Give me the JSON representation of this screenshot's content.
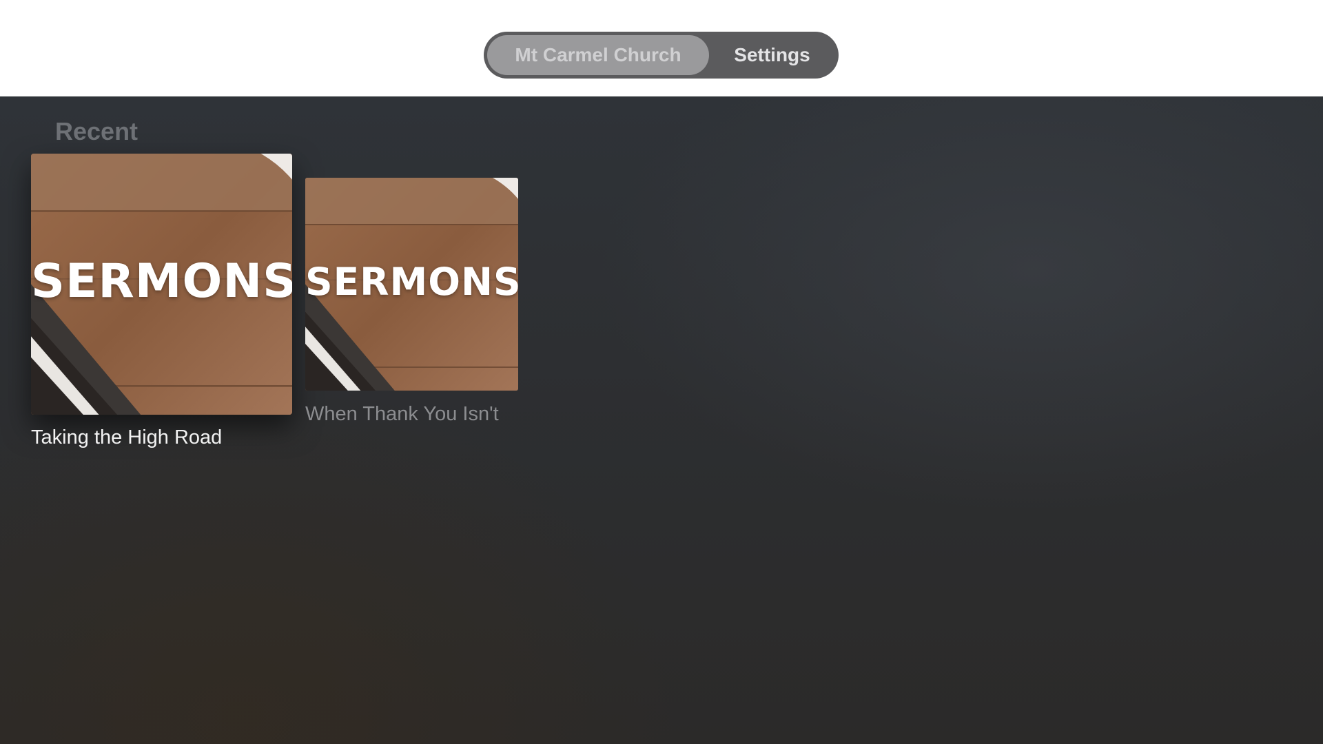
{
  "tabs": [
    {
      "label": "Mt Carmel Church",
      "selected": true
    },
    {
      "label": "Settings",
      "selected": false
    }
  ],
  "section": {
    "title": "Recent"
  },
  "items": [
    {
      "title": "Taking the High Road",
      "art_text": "SERMONS",
      "focused": true
    },
    {
      "title": "When Thank You Isn't",
      "art_text": "SERMONS",
      "focused": false
    }
  ],
  "colors": {
    "background_top": "#2f3338",
    "background_bottom": "#2b2a29",
    "tab_bar": "#5b5b5d",
    "tab_selected": "#9a9a9c",
    "wood": "#8a5f40"
  }
}
